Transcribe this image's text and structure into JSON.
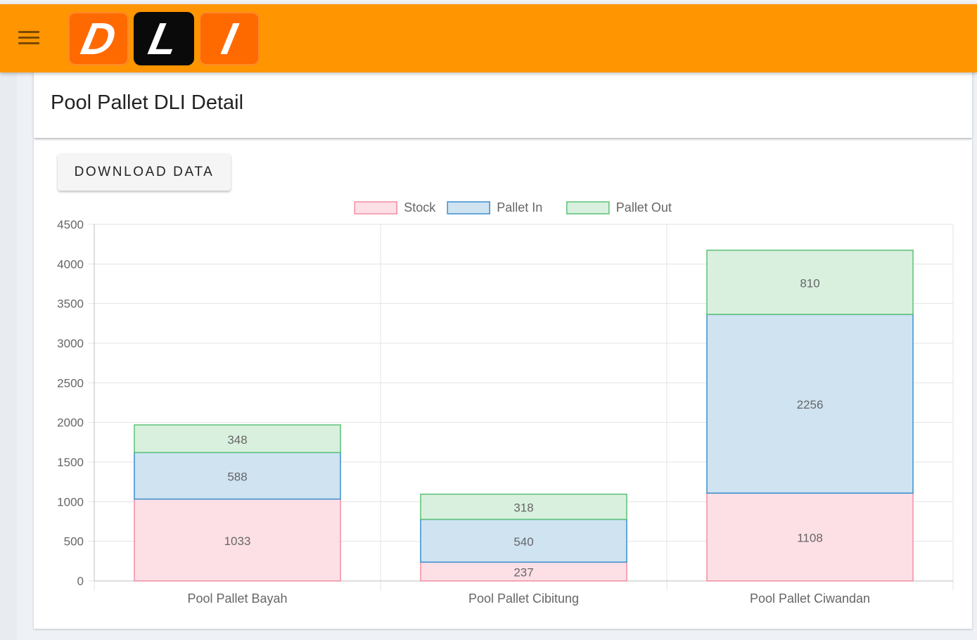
{
  "app": {
    "logo_letters": [
      "D",
      "L",
      "I"
    ],
    "menu_icon": "hamburger-menu-icon"
  },
  "page": {
    "title": "Pool Pallet DLI Detail",
    "download_label": "DOWNLOAD DATA"
  },
  "colors": {
    "topbar": "#ff9500",
    "logo_orange": "#ff6a00",
    "logo_black": "#0a0a0a"
  },
  "chart_data": {
    "type": "bar",
    "stacked": true,
    "categories": [
      "Pool Pallet Bayah",
      "Pool Pallet Cibitung",
      "Pool Pallet Ciwandan"
    ],
    "series": [
      {
        "name": "Stock",
        "values": [
          1033,
          237,
          1108
        ],
        "fill": "#fde0e6",
        "stroke": "#f28da4"
      },
      {
        "name": "Pallet In",
        "values": [
          588,
          540,
          2256
        ],
        "fill": "#cfe3f1",
        "stroke": "#3a8fcf"
      },
      {
        "name": "Pallet Out",
        "values": [
          348,
          318,
          810
        ],
        "fill": "#d9f0de",
        "stroke": "#5cc176"
      }
    ],
    "ylim": [
      0,
      4500
    ],
    "yticks": [
      0,
      500,
      1000,
      1500,
      2000,
      2500,
      3000,
      3500,
      4000,
      4500
    ],
    "legend_position": "top-center",
    "grid": true,
    "data_labels": true
  }
}
